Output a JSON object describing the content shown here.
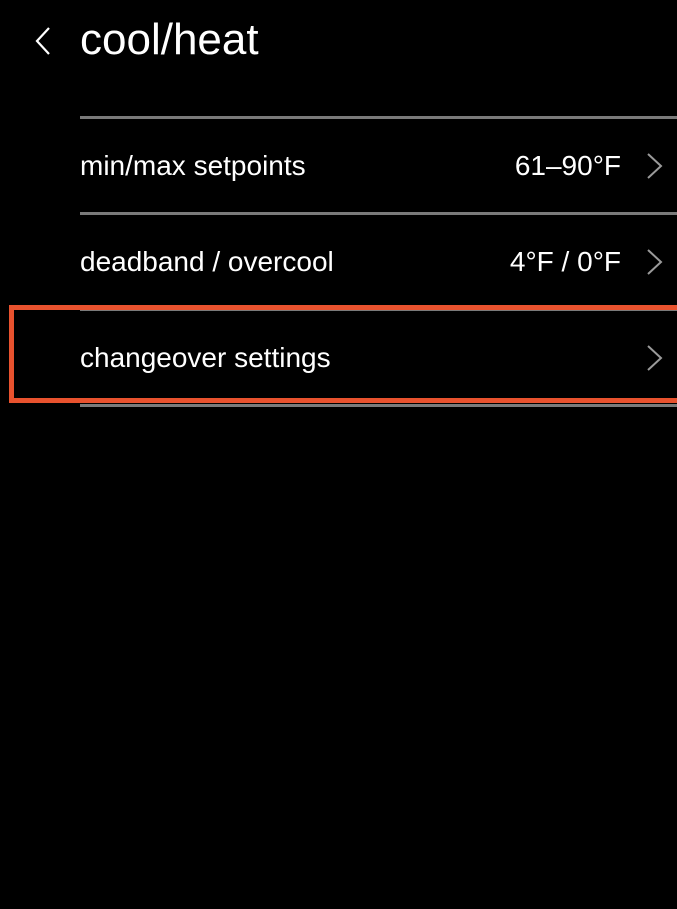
{
  "header": {
    "title": "cool/heat",
    "back_icon": "chevron-left-icon"
  },
  "settings": {
    "items": [
      {
        "label": "min/max setpoints",
        "value": "61–90°F",
        "icon": "chevron-right-icon"
      },
      {
        "label": "deadband / overcool",
        "value": "4°F / 0°F",
        "icon": "chevron-right-icon"
      },
      {
        "label": "changeover settings",
        "value": "",
        "icon": "chevron-right-icon"
      }
    ]
  },
  "colors": {
    "background": "#000000",
    "text": "#ffffff",
    "divider": "#7a7a7a",
    "chevron": "#9a9a9a",
    "highlight": "#e8522e"
  }
}
